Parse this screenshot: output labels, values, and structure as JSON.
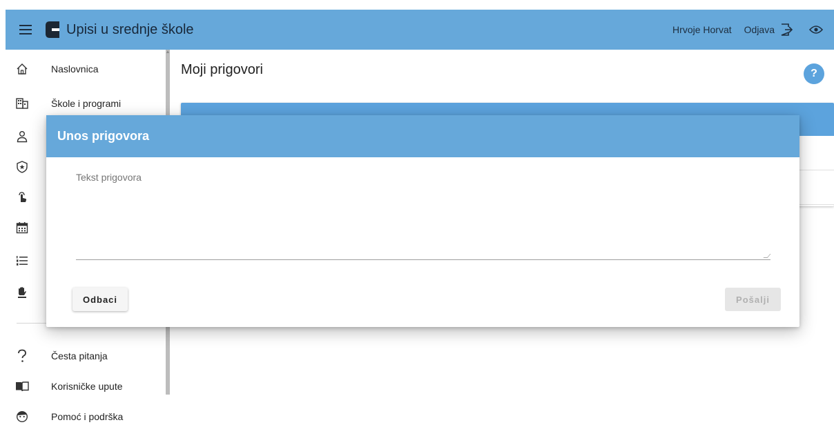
{
  "header": {
    "app_title": "Upisi u srednje škole",
    "user_name": "Hrvoje Horvat",
    "logout_label": "Odjava",
    "bar_color": "#66a8da"
  },
  "sidebar": {
    "items": [
      {
        "label": "Naslovnica",
        "icon": "home-icon"
      },
      {
        "label": "Škole i programi",
        "icon": "building-icon"
      },
      {
        "label": "",
        "icon": "user-icon"
      },
      {
        "label": "",
        "icon": "badge-star-icon"
      },
      {
        "label": "",
        "icon": "tap-finger-icon"
      },
      {
        "label": "",
        "icon": "calendar-icon"
      },
      {
        "label": "",
        "icon": "numbered-list-icon"
      },
      {
        "label": "",
        "icon": "hand-vote-icon"
      }
    ],
    "bottom_items": [
      {
        "label": "Česta pitanja",
        "icon": "question-icon"
      },
      {
        "label": "Korisničke upute",
        "icon": "book-icon"
      },
      {
        "label": "Pomoć i podrška",
        "icon": "support-icon"
      }
    ]
  },
  "main": {
    "page_title": "Moji prigovori",
    "help_label": "?"
  },
  "dialog": {
    "title": "Unos prigovora",
    "textarea_label": "Tekst prigovora",
    "textarea_value": "",
    "discard_label": "Odbaci",
    "send_label": "Pošalji",
    "header_color": "#66a8da"
  }
}
